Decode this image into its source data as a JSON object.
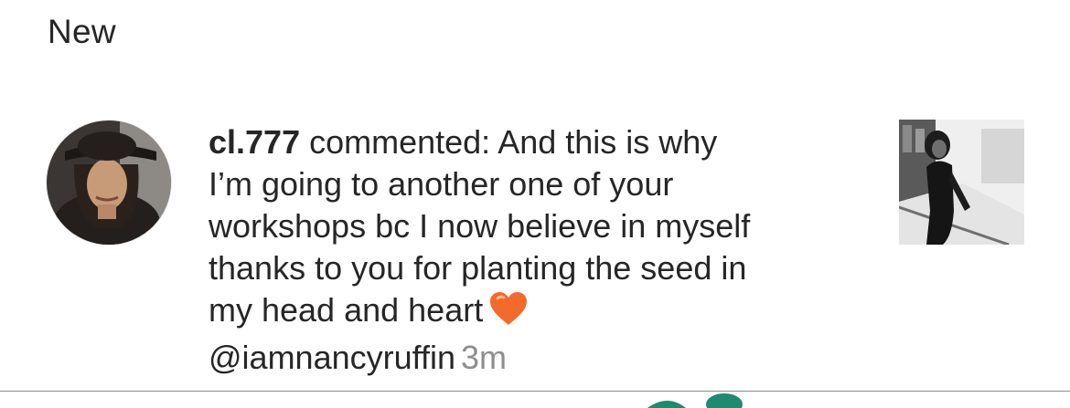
{
  "section": {
    "title": "New"
  },
  "notification": {
    "username": "cl.777",
    "comment_lines": [
      " commented: And this is why",
      "I’m going to another one of your",
      "workshops bc I now believe in myself",
      "thanks to you for planting the seed in",
      "my head and heart"
    ],
    "mention": "@iamnancyruffin",
    "timestamp": "3m",
    "heart_icon": "orange-heart-emoji"
  },
  "colors": {
    "text": "#262626",
    "muted": "#8e8e8e",
    "divider": "#8a8a8a",
    "heart": "#f26b2a",
    "partial_logo": "#1f8a70"
  }
}
